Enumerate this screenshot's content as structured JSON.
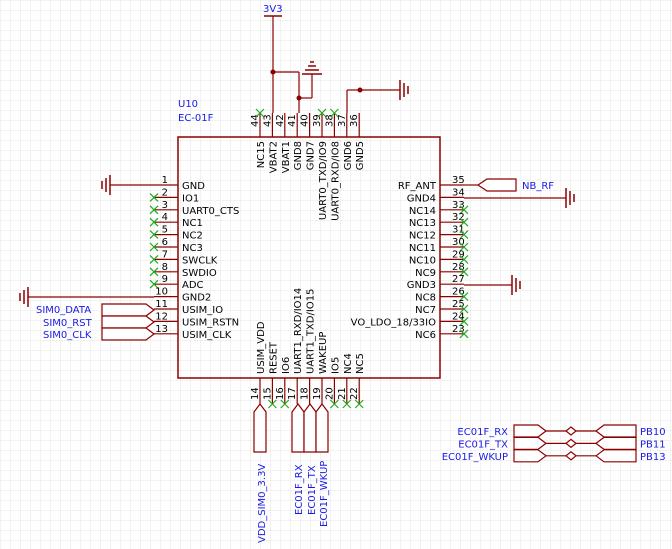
{
  "power": {
    "label": "3V3"
  },
  "component": {
    "ref": "U10",
    "value": "EC-01F"
  },
  "pins": {
    "left": [
      {
        "num": "1",
        "name": "GND"
      },
      {
        "num": "2",
        "name": "IO1"
      },
      {
        "num": "3",
        "name": "UART0_CTS"
      },
      {
        "num": "4",
        "name": "NC1"
      },
      {
        "num": "5",
        "name": "NC2"
      },
      {
        "num": "6",
        "name": "NC3"
      },
      {
        "num": "7",
        "name": "SWCLK"
      },
      {
        "num": "8",
        "name": "SWDIO"
      },
      {
        "num": "9",
        "name": "ADC"
      },
      {
        "num": "10",
        "name": "GND2"
      },
      {
        "num": "11",
        "name": "USIM_IO"
      },
      {
        "num": "12",
        "name": "USIM_RSTN"
      },
      {
        "num": "13",
        "name": "USIM_CLK"
      }
    ],
    "right": [
      {
        "num": "35",
        "name": "RF_ANT"
      },
      {
        "num": "34",
        "name": "GND4"
      },
      {
        "num": "33",
        "name": "NC14"
      },
      {
        "num": "32",
        "name": "NC13"
      },
      {
        "num": "31",
        "name": "NC12"
      },
      {
        "num": "30",
        "name": "NC11"
      },
      {
        "num": "29",
        "name": "NC10"
      },
      {
        "num": "28",
        "name": "NC9"
      },
      {
        "num": "27",
        "name": "GND3"
      },
      {
        "num": "26",
        "name": "NC8"
      },
      {
        "num": "25",
        "name": "NC7"
      },
      {
        "num": "24",
        "name": "VO_LDO_18/33IO"
      },
      {
        "num": "23",
        "name": "NC6"
      }
    ],
    "top": [
      {
        "num": "44",
        "name": "NC15"
      },
      {
        "num": "43",
        "name": "VBAT2"
      },
      {
        "num": "42",
        "name": "VBAT1"
      },
      {
        "num": "41",
        "name": "GND8"
      },
      {
        "num": "40",
        "name": "GND7"
      },
      {
        "num": "39",
        "name": "UART0_TXD/IO9"
      },
      {
        "num": "38",
        "name": "UART0_RXD/IO8"
      },
      {
        "num": "37",
        "name": "GND6"
      },
      {
        "num": "36",
        "name": "GND5"
      }
    ],
    "bottom": [
      {
        "num": "14",
        "name": "USIM_VDD"
      },
      {
        "num": "15",
        "name": "RESET"
      },
      {
        "num": "16",
        "name": "IO6"
      },
      {
        "num": "17",
        "name": "UART1_RXD/IO14"
      },
      {
        "num": "18",
        "name": "UART1_TXD/IO15"
      },
      {
        "num": "19",
        "name": "WAKEUP"
      },
      {
        "num": "20",
        "name": "IO5"
      },
      {
        "num": "21",
        "name": "NC4"
      },
      {
        "num": "22",
        "name": "NC5"
      }
    ]
  },
  "nets": {
    "left": [
      "SIM0_DATA",
      "SIM0_RST",
      "SIM0_CLK"
    ],
    "right": [
      "NB_RF"
    ],
    "bottom": [
      "VDD_SIM0_3.3V",
      "EC01F_RX",
      "EC01F_TX",
      "EC01F_WKUP"
    ],
    "links": [
      {
        "left": "EC01F_RX",
        "right": "PB10"
      },
      {
        "left": "EC01F_TX",
        "right": "PB11"
      },
      {
        "left": "EC01F_WKUP",
        "right": "PB13"
      }
    ]
  }
}
